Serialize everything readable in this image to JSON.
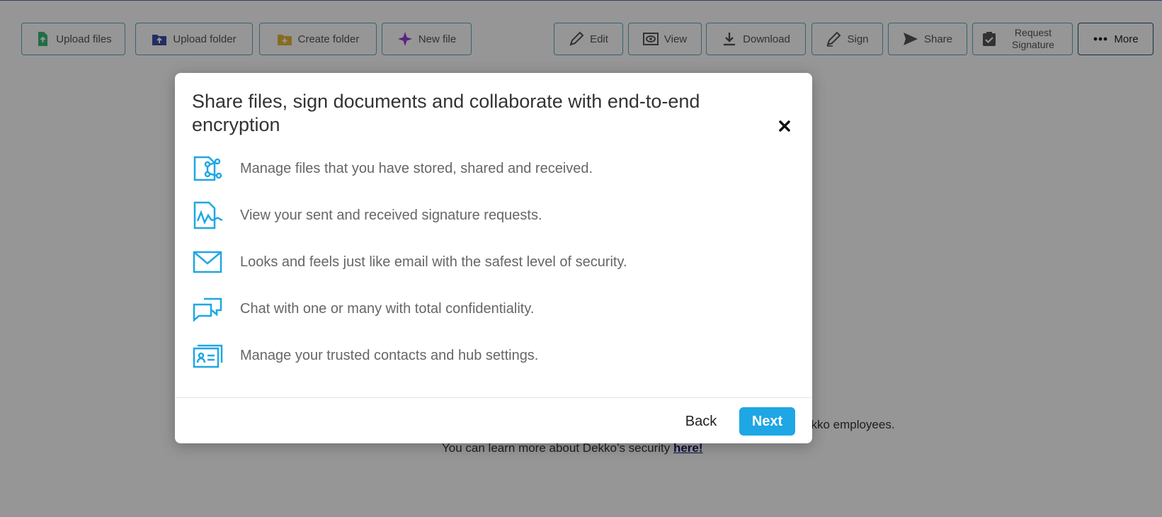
{
  "toolbar": {
    "buttons": [
      {
        "label": "Upload files",
        "icon": "upload-file-icon"
      },
      {
        "label": "Upload folder",
        "icon": "upload-folder-icon"
      },
      {
        "label": "Create folder",
        "icon": "create-folder-icon"
      },
      {
        "label": "New file",
        "icon": "sparkle-icon"
      },
      {
        "label": "Edit",
        "icon": "edit-icon"
      },
      {
        "label": "View",
        "icon": "eye-icon"
      },
      {
        "label": "Download",
        "icon": "download-icon"
      },
      {
        "label": "Sign",
        "icon": "signature-pen-icon"
      },
      {
        "label": "Share",
        "icon": "send-icon"
      },
      {
        "label": "Request Signature",
        "icon": "clipboard-check-icon"
      },
      {
        "label": "More",
        "icon": "dots-icon"
      }
    ]
  },
  "background": {
    "line1": "ekko employees.",
    "line2_prefix": "You can learn more about Dekko’s security ",
    "line2_link": "here!"
  },
  "modal": {
    "title": "Share files, sign documents and collaborate with end-to-end encryption",
    "features": [
      {
        "text": "Manage files that you have stored, shared and received.",
        "icon": "file-share-icon"
      },
      {
        "text": "View your sent and received signature requests.",
        "icon": "signature-document-icon"
      },
      {
        "text": "Looks and feels just like email with the safest level of security.",
        "icon": "envelope-icon"
      },
      {
        "text": "Chat with one or many with total confidentiality.",
        "icon": "chat-bubbles-icon"
      },
      {
        "text": "Manage your trusted contacts and hub settings.",
        "icon": "contact-card-icon"
      }
    ],
    "back_label": "Back",
    "next_label": "Next"
  },
  "colors": {
    "accent": "#1ea7e4",
    "overlay": "rgba(0,0,0,0.41)",
    "toolbar_border": "#5aa8c4"
  }
}
